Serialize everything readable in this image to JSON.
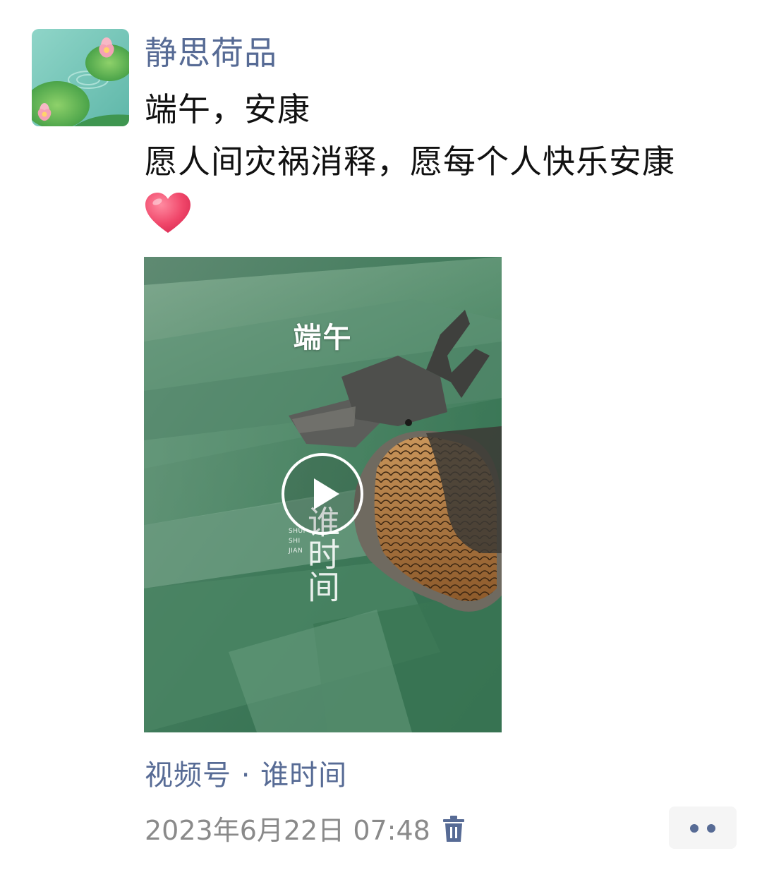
{
  "post": {
    "author": "静思荷品",
    "text_lines": [
      "端午，安康",
      "愿人间灾祸消释，愿每个人快乐安康"
    ],
    "emoji_icon": "red-heart-icon"
  },
  "video": {
    "title": "端午",
    "watermark_main": "谁时间",
    "watermark_small": [
      "SHUI",
      "SHI",
      "JIAN"
    ],
    "play_icon": "play-icon"
  },
  "footer": {
    "channel": "视频号 · 谁时间",
    "timestamp": "2023年6月22日 07:48",
    "delete_icon": "trash-icon",
    "more_icon": "more-dots-icon"
  },
  "colors": {
    "link": "#576b95",
    "meta": "#8a8a8a",
    "heart": "#f0476a",
    "more_bg": "#f5f5f5"
  }
}
